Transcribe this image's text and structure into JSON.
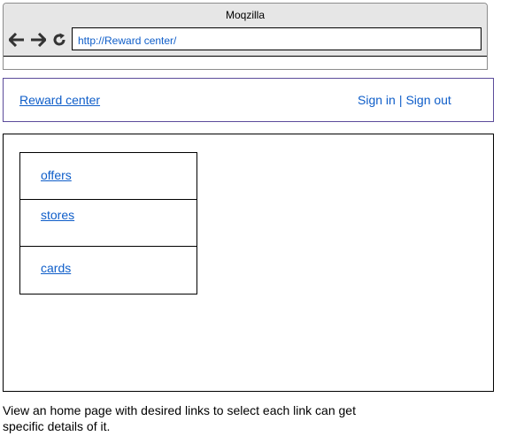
{
  "browser": {
    "title": "Moqzilla",
    "url": "http://Reward center/",
    "icons": [
      "arrow-left-icon",
      "arrow-right-icon",
      "reload-icon"
    ]
  },
  "header": {
    "site_name": "Reward center",
    "sign_in": "Sign in",
    "separator": "|",
    "sign_out": "Sign out"
  },
  "menu": {
    "items": [
      {
        "label": "offers"
      },
      {
        "label": "stores"
      },
      {
        "label": "cards"
      }
    ]
  },
  "caption": "View an home page with desired links to select each link can get specific details of it.",
  "colors": {
    "link": "#0f5ec9",
    "chrome": "#e6e6e6",
    "header_border": "#5b4b9a"
  }
}
